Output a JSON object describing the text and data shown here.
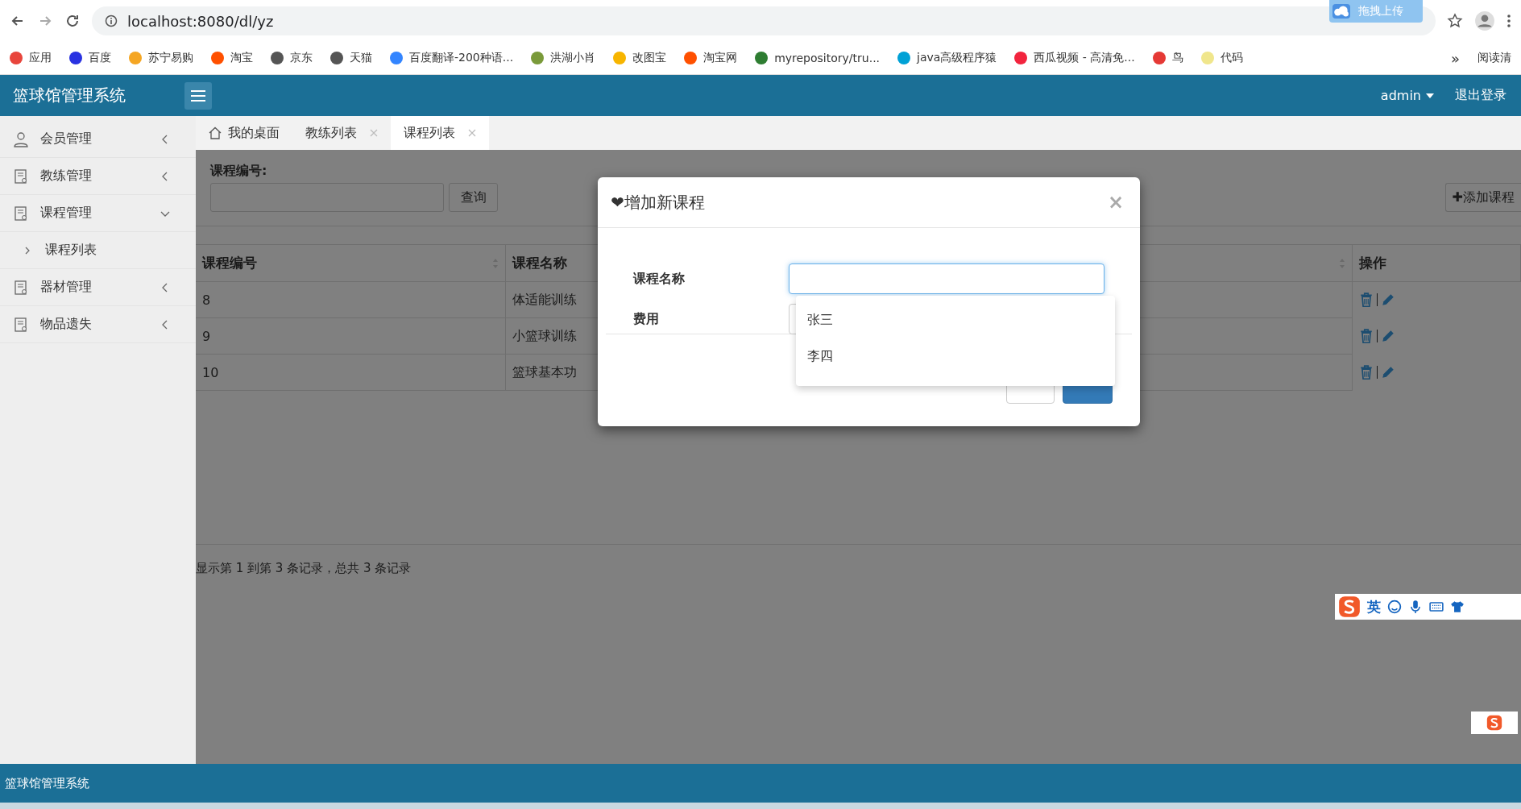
{
  "browser": {
    "address": "localhost:8080/dl/yz",
    "upload_badge": "拖拽上传",
    "bookmarks": [
      {
        "label": "应用",
        "color": "#e8453c"
      },
      {
        "label": "百度",
        "color": "#2932e1"
      },
      {
        "label": "苏宁易购",
        "color": "#f5a623"
      },
      {
        "label": "淘宝",
        "color": "#ff5000"
      },
      {
        "label": "京东",
        "color": "#555555"
      },
      {
        "label": "天猫",
        "color": "#555555"
      },
      {
        "label": "百度翻译-200种语...",
        "color": "#3385ff"
      },
      {
        "label": "洪湖小肖",
        "color": "#7a9a3a"
      },
      {
        "label": "改图宝",
        "color": "#f7b500"
      },
      {
        "label": "淘宝网",
        "color": "#ff5000"
      },
      {
        "label": "myrepository/tru...",
        "color": "#2e7d32"
      },
      {
        "label": "java高级程序猿",
        "color": "#00a1d6"
      },
      {
        "label": "西瓜视频 - 高清免...",
        "color": "#f2243e"
      },
      {
        "label": "鸟",
        "color": "#e53935"
      },
      {
        "label": "代码",
        "color": "#f0e68c"
      }
    ],
    "more": "»",
    "reading_list": "阅读清"
  },
  "header": {
    "title": "篮球馆管理系统",
    "user": "admin",
    "logout": "退出登录"
  },
  "sidebar": {
    "items": [
      {
        "label": "会员管理",
        "kind": "person",
        "expanded": false
      },
      {
        "label": "教练管理",
        "kind": "doc",
        "expanded": false
      },
      {
        "label": "课程管理",
        "kind": "doc",
        "expanded": true,
        "children": [
          {
            "label": "课程列表"
          }
        ]
      },
      {
        "label": "器材管理",
        "kind": "doc",
        "expanded": false
      },
      {
        "label": "物品遗失",
        "kind": "doc",
        "expanded": false
      }
    ]
  },
  "tabs": [
    {
      "label": "我的桌面",
      "kind": "home",
      "selected": false
    },
    {
      "label": "教练列表",
      "kind": "closable",
      "selected": false
    },
    {
      "label": "课程列表",
      "kind": "closable",
      "selected": true
    }
  ],
  "search": {
    "label": "课程编号:",
    "button": "查询"
  },
  "add_button": "✚添加课程",
  "table": {
    "columns": [
      "课程编号",
      "课程名称",
      "操作"
    ],
    "rows": [
      {
        "id": "8",
        "name": "体适能训练"
      },
      {
        "id": "9",
        "name": "小篮球训练"
      },
      {
        "id": "10",
        "name": "篮球基本功"
      }
    ]
  },
  "pagination": "显示第 1 到第 3 条记录，总共 3 条记录",
  "modal": {
    "title": "❤增加新课程",
    "close": "×",
    "fields": [
      {
        "label": "课程名称"
      },
      {
        "label": "费用"
      }
    ],
    "suggestions": [
      "张三",
      "李四"
    ]
  },
  "ime": {
    "mode": "英"
  },
  "footer": "篮球馆管理系统"
}
